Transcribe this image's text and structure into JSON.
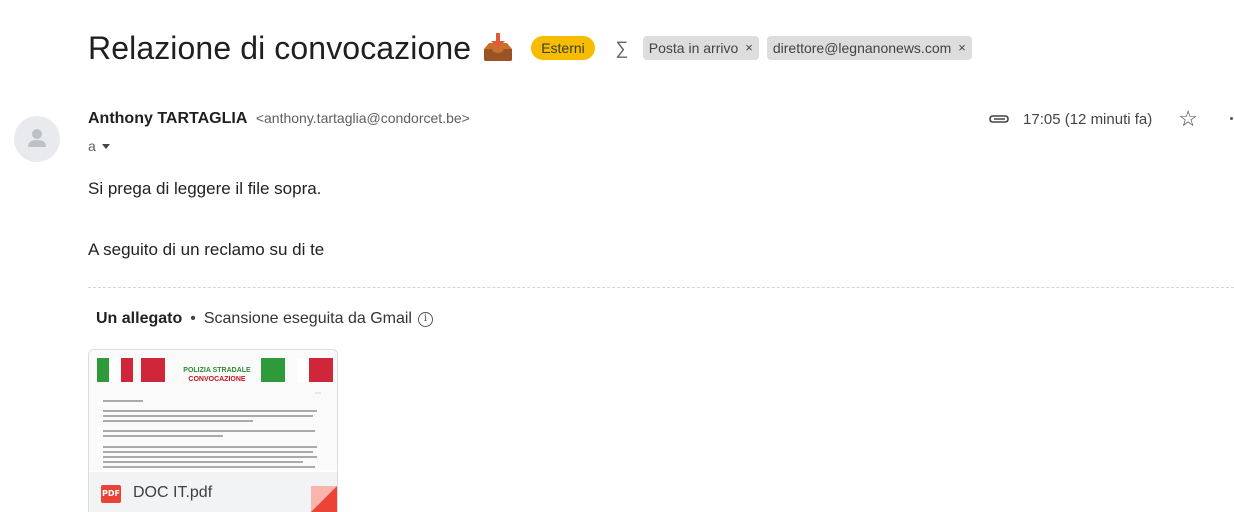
{
  "subject": {
    "title": "Relazione di convocazione",
    "badge": "Esterni",
    "labels": [
      {
        "text": "Posta in arrivo",
        "close": "×"
      },
      {
        "text": "direttore@legnanonews.com",
        "close": "×"
      }
    ]
  },
  "message": {
    "sender_name": "Anthony TARTAGLIA",
    "sender_email": "<anthony.tartaglia@condorcet.be>",
    "to_label": "a",
    "time": "17:05 (12 minuti fa)",
    "star": "☆",
    "body": [
      "Si prega di leggere il file sopra.",
      "A seguito di un reclamo su di te"
    ]
  },
  "attachments": {
    "count_label": "Un allegato",
    "separator": "•",
    "scan_label": "Scansione eseguita da Gmail",
    "file": {
      "name": "DOC IT.pdf",
      "type_label": "PDF",
      "preview_title_1": "POLIZIA STRADALE",
      "preview_title_2": "CONVOCAZIONE"
    }
  },
  "colors": {
    "badge_bg": "#f5bc00",
    "pdf_red": "#ea4335",
    "flag_green": "#2e9a3a",
    "flag_red": "#d0263a"
  }
}
